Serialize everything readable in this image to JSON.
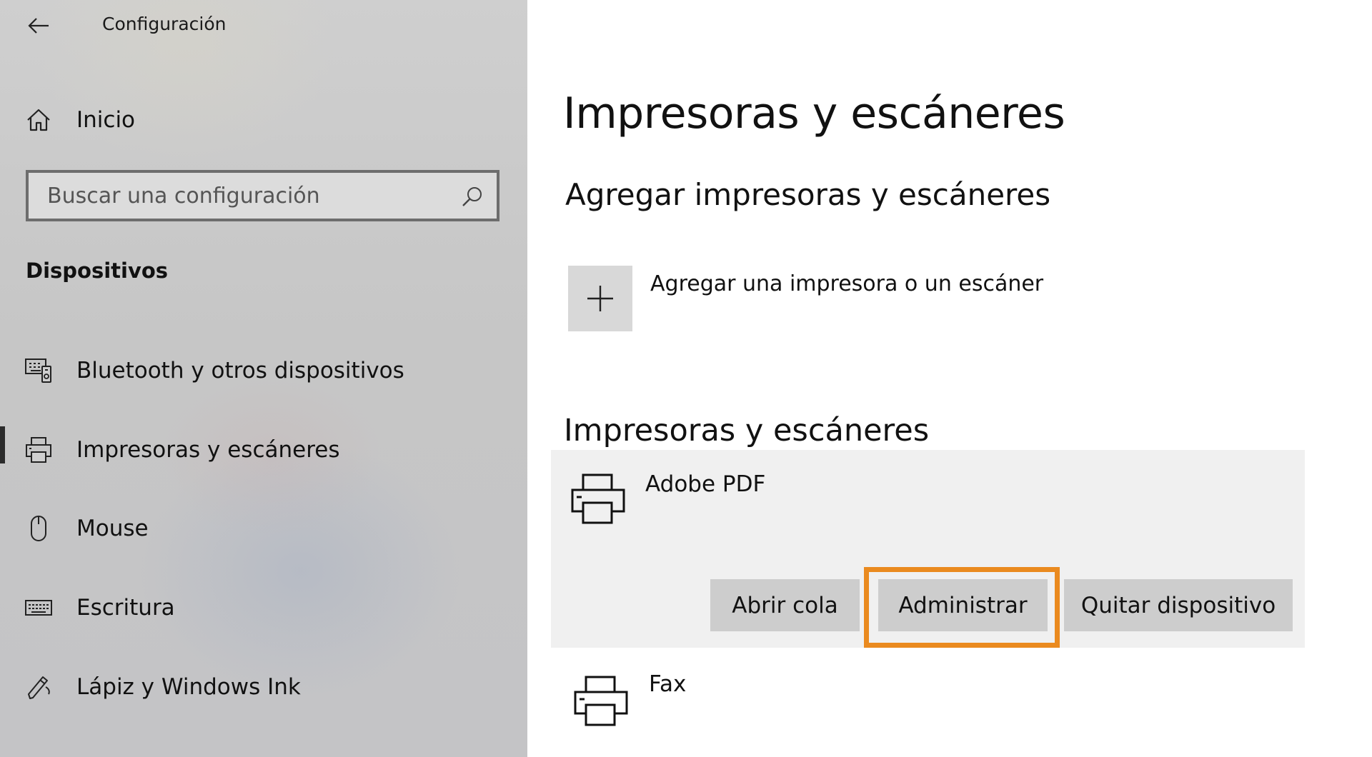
{
  "window": {
    "title": "Configuración"
  },
  "sidebar": {
    "home_label": "Inicio",
    "search": {
      "placeholder": "Buscar una configuración"
    },
    "section_header": "Dispositivos",
    "items": [
      {
        "label": "Bluetooth y otros dispositivos",
        "icon": "bluetooth-devices-icon"
      },
      {
        "label": "Impresoras y escáneres",
        "icon": "printer-icon",
        "selected": true
      },
      {
        "label": "Mouse",
        "icon": "mouse-icon"
      },
      {
        "label": "Escritura",
        "icon": "keyboard-icon"
      },
      {
        "label": "Lápiz y Windows Ink",
        "icon": "pen-icon"
      }
    ]
  },
  "main": {
    "page_title": "Impresoras y escáneres",
    "add_section": {
      "title": "Agregar impresoras y escáneres",
      "add_label": "Agregar una impresora o un escáner"
    },
    "list_section": {
      "title": "Impresoras y escáneres",
      "devices": [
        {
          "name": "Adobe PDF",
          "expanded": true,
          "actions": {
            "open_queue": "Abrir cola",
            "manage": "Administrar",
            "remove": "Quitar dispositivo"
          }
        },
        {
          "name": "Fax",
          "expanded": false
        }
      ]
    }
  },
  "colors": {
    "highlight": "#ea8a1f",
    "card_background": "#f0f0f0",
    "button_background": "#cdcdcd"
  }
}
